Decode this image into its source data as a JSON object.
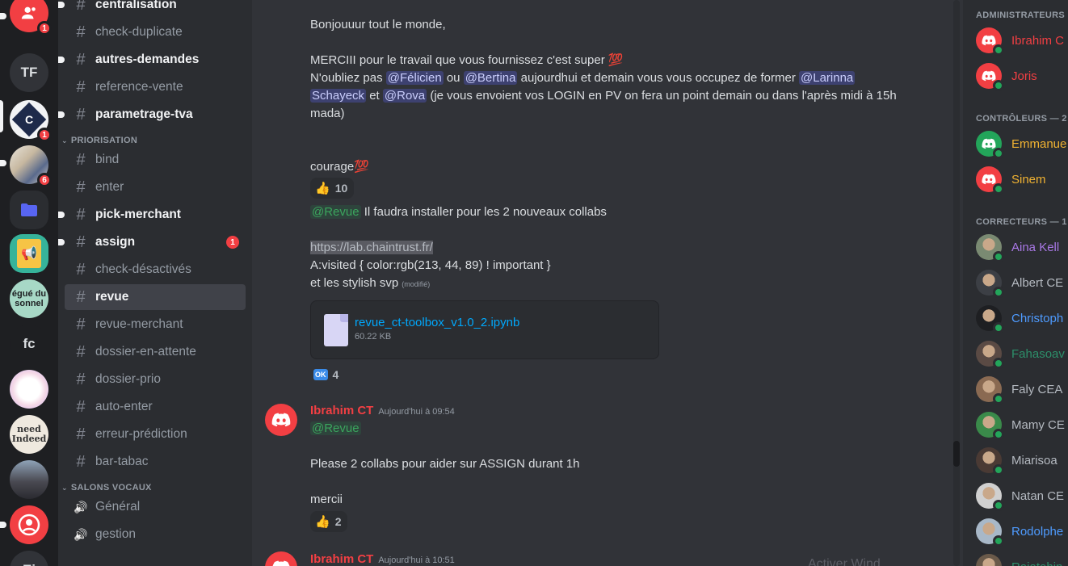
{
  "colors": {
    "red": "#f23f43",
    "admin": "#f23f43",
    "controller": "#f0b232",
    "green_mention": "#3ba55d",
    "link": "#00a8fc"
  },
  "servers": [
    {
      "initials": "",
      "badge": "1",
      "icon": "users-icon"
    },
    {
      "initials": "TF",
      "badge": ""
    },
    {
      "initials": "C",
      "badge": "1"
    },
    {
      "initials": "",
      "badge": "6"
    },
    {
      "initials": "",
      "badge": "",
      "icon": "folder-icon"
    },
    {
      "initials": "",
      "badge": ""
    },
    {
      "initials": "égué du sonnel",
      "badge": ""
    },
    {
      "initials": "fc",
      "badge": ""
    },
    {
      "initials": "",
      "badge": ""
    },
    {
      "initials": "need Indeed",
      "badge": ""
    },
    {
      "initials": "",
      "badge": ""
    },
    {
      "initials": "",
      "badge": ""
    },
    {
      "initials": "Ei",
      "badge": ""
    }
  ],
  "channels": {
    "top": [
      {
        "name": "centralisation",
        "unread": true
      },
      {
        "name": "check-duplicate",
        "unread": false
      },
      {
        "name": "autres-demandes",
        "unread": true
      },
      {
        "name": "reference-vente",
        "unread": false
      },
      {
        "name": "parametrage-tva",
        "unread": true
      }
    ],
    "category_priorisation": "PRIORISATION",
    "priorisation": [
      {
        "name": "bind",
        "unread": false
      },
      {
        "name": "enter",
        "unread": false
      },
      {
        "name": "pick-merchant",
        "unread": true
      },
      {
        "name": "assign",
        "unread": true,
        "mention": "1"
      },
      {
        "name": "check-désactivés",
        "unread": false
      },
      {
        "name": "revue",
        "active": true
      },
      {
        "name": "revue-merchant",
        "unread": false
      },
      {
        "name": "dossier-en-attente",
        "unread": false
      },
      {
        "name": "dossier-prio",
        "unread": false
      },
      {
        "name": "auto-enter",
        "unread": false
      },
      {
        "name": "erreur-prédiction",
        "unread": false
      },
      {
        "name": "bar-tabac",
        "unread": false
      }
    ],
    "category_voice": "SALONS VOCAUX",
    "voice": [
      {
        "name": "Général"
      },
      {
        "name": "gestion"
      }
    ]
  },
  "messages": {
    "m1": {
      "greeting": "Bonjouuur tout le monde,",
      "line2": "MERCIII pour le travail que vous fournissez c'est super",
      "line2_emoji": "💯",
      "line3_a": "N'oubliez pas ",
      "mention_felicien": "@Félicien",
      "line3_b": " ou ",
      "mention_bertina": "@Bertina",
      "line3_c": " aujourdhui et demain vous vous occupez de former ",
      "mention_larinna_1": "@Larinna",
      "mention_larinna_2": "Schayeck",
      "line4_b": " et ",
      "mention_rova": "@Rova",
      "line4_c": " (je vous envoient vos LOGIN en PV on fera un point demain ou dans l'après midi à 15h",
      "line5": "mada)",
      "courage": "courage",
      "courage_emoji": "💯",
      "reaction1_emoji": "👍",
      "reaction1_count": "10",
      "role_mention": "@Revue",
      "install": " Il faudra installer pour les 2 nouveaux collabs",
      "link": "https://lab.chaintrust.fr/",
      "css_line": "A:visited { color:rgb(213, 44, 89) ! important }",
      "svp_line": "et les stylish svp",
      "edited": "(modifié)",
      "file_name": "revue_ct-toolbox_v1.0_2.ipynb",
      "file_size": "60.22 KB",
      "reaction2_emoji": "OK",
      "reaction2_count": "4"
    },
    "m2": {
      "author": "Ibrahim CT",
      "timestamp": "Aujourd'hui à 09:54",
      "role_mention": "@Revue",
      "body": "Please 2 collabs pour aider sur ASSIGN durant 1h",
      "body2": "mercii",
      "reaction_emoji": "👍",
      "reaction_count": "2"
    },
    "m3": {
      "author": "Ibrahim CT",
      "timestamp": "Aujourd'hui à 10:51"
    },
    "watermark": "Activer Wind"
  },
  "members": {
    "cat_admin": "ADMINISTRATEURS",
    "cat_ctrl": "CONTRÔLEURS — 2",
    "cat_corr": "CORRECTEURS — 1",
    "admins": [
      {
        "name": "Ibrahim C",
        "color": "#f23f43"
      },
      {
        "name": "Joris",
        "color": "#f23f43"
      }
    ],
    "controllers": [
      {
        "name": "Emmanue",
        "color": "#f0b232",
        "avatar": "#23a55a"
      },
      {
        "name": "Sinem",
        "color": "#f0b232",
        "avatar": "#f23f43"
      }
    ],
    "correctors": [
      {
        "name": "Aina Kell",
        "color": "#a978e6"
      },
      {
        "name": "Albert CE",
        "color": "#b5bac1"
      },
      {
        "name": "Christoph",
        "color": "#4e9bff"
      },
      {
        "name": "Fahasoav",
        "color": "#2c8f6a"
      },
      {
        "name": "Faly CEA",
        "color": "#b5bac1"
      },
      {
        "name": "Mamy CE",
        "color": "#b5bac1"
      },
      {
        "name": "Miarisoa",
        "color": "#b5bac1"
      },
      {
        "name": "Natan CE",
        "color": "#b5bac1"
      },
      {
        "name": "Rodolphe",
        "color": "#4e9bff"
      },
      {
        "name": "Raiatehin",
        "color": "#2c8f6a"
      }
    ]
  }
}
